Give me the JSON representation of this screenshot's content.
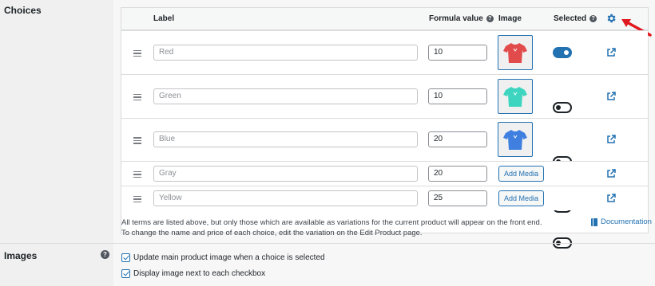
{
  "sections": {
    "choices_title": "Choices",
    "images_title": "Images"
  },
  "table": {
    "headers": {
      "label": "Label",
      "formula_value": "Formula value",
      "image": "Image",
      "selected": "Selected"
    },
    "rows": [
      {
        "label": "Red",
        "formula_value": "10",
        "image": "tshirt-red",
        "shirt_color": "#e24b4b",
        "selected": true
      },
      {
        "label": "Green",
        "formula_value": "10",
        "image": "tshirt-green",
        "shirt_color": "#3dd5c0",
        "selected": false
      },
      {
        "label": "Blue",
        "formula_value": "20",
        "image": "tshirt-blue",
        "shirt_color": "#3f7fe0",
        "selected": false
      },
      {
        "label": "Gray",
        "formula_value": "20",
        "image_button": "Add Media",
        "selected": false
      },
      {
        "label": "Yellow",
        "formula_value": "25",
        "image_button": "Add Media",
        "selected": false
      }
    ]
  },
  "notes": {
    "line1": "All terms are listed above, but only those which are available as variations for the current product will appear on the front end.",
    "line2": "To change the name and price of each choice, edit the variation on the Edit Product page."
  },
  "documentation_link": "Documentation",
  "images_options": [
    {
      "label": "Update main product image when a choice is selected",
      "checked": true
    },
    {
      "label": "Display image next to each checkbox",
      "checked": true
    }
  ],
  "colors": {
    "accent": "#2271b1",
    "arrow": "#e0191f"
  },
  "icons": [
    "help-icon",
    "gear-icon",
    "drag-handle-icon",
    "external-link-icon",
    "book-icon",
    "arrow-annotation"
  ]
}
